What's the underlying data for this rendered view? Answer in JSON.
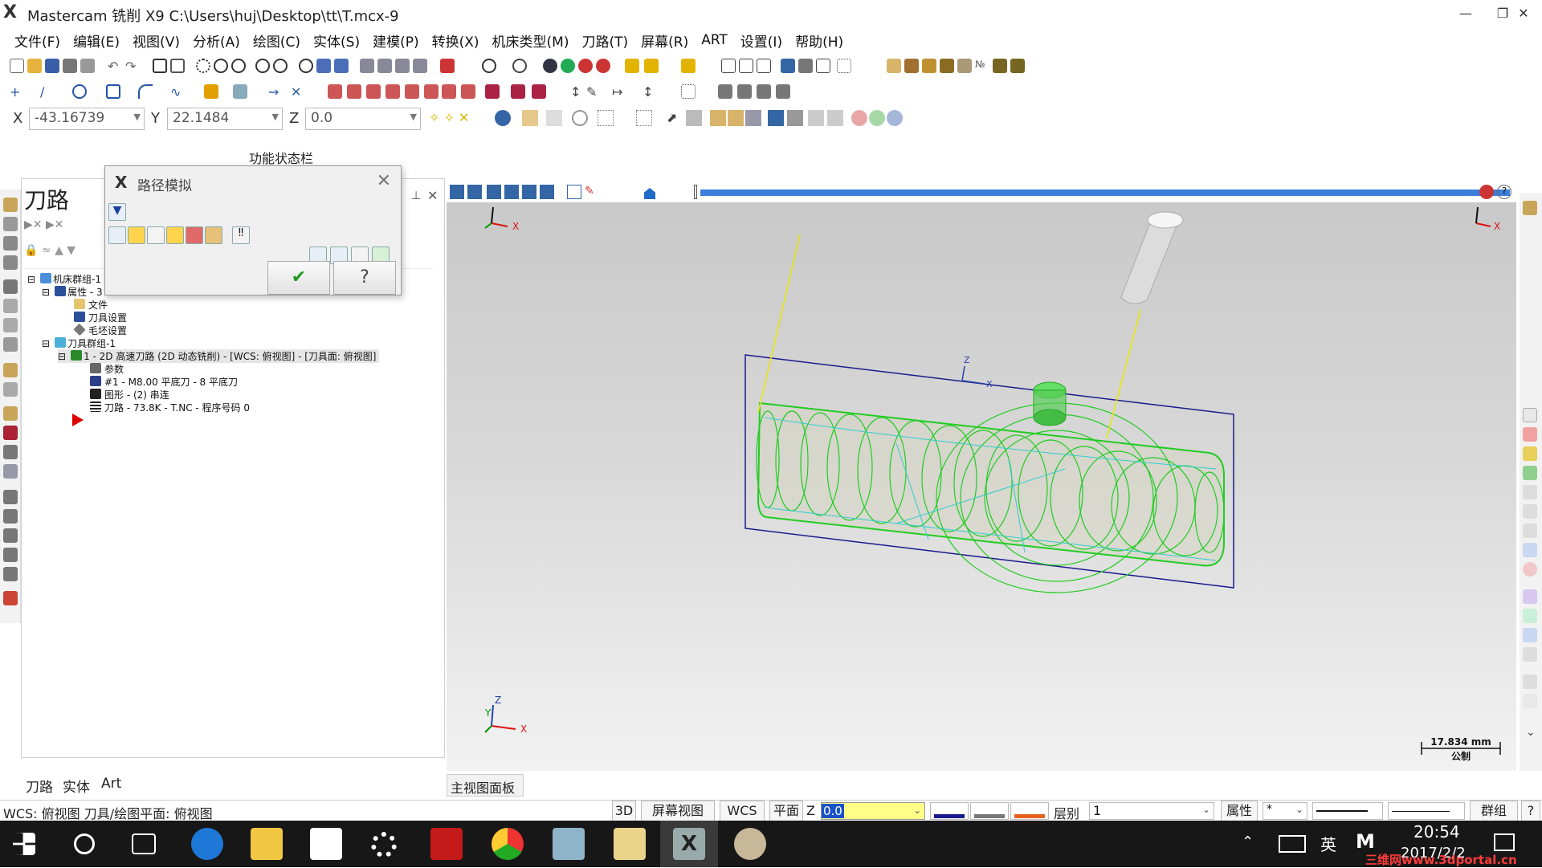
{
  "app": {
    "title": "Mastercam 铣削 X9  C:\\Users\\huj\\Desktop\\tt\\T.mcx-9"
  },
  "menu": [
    "文件(F)",
    "编辑(E)",
    "视图(V)",
    "分析(A)",
    "绘图(C)",
    "实体(S)",
    "建模(P)",
    "转换(X)",
    "机床类型(M)",
    "刀路(T)",
    "屏幕(R)",
    "ART",
    "设置(I)",
    "帮助(H)"
  ],
  "coords": {
    "x_label": "X",
    "x_value": "-43.16739",
    "y_label": "Y",
    "y_value": "22.1484",
    "z_label": "Z",
    "z_value": "0.0"
  },
  "function_status_label": "功能状态栏",
  "panel": {
    "title": "刀路",
    "tree": [
      "机床群组-1",
      "属性 - 3",
      "文件",
      "刀具设置",
      "毛坯设置",
      "刀具群组-1",
      "1 - 2D 高速刀路 (2D 动态铣削) - [WCS: 俯视图] - [刀具面: 俯视图]",
      "参数",
      "#1 - M8.00 平底刀 - 8 平底刀",
      "图形 - (2) 串连",
      "刀路 - 73.8K - T.NC - 程序号码 0"
    ],
    "tabs": [
      "刀路",
      "实体",
      "Art"
    ]
  },
  "dialog": {
    "title": "路径模拟"
  },
  "viewport": {
    "tab_label": "主视图面板",
    "axis_x": "X",
    "axis_y": "Y",
    "axis_z": "Z",
    "scale_value": "17.834 mm",
    "scale_unit": "公制"
  },
  "statusbar": {
    "wcs_text": "WCS: 俯视图  刀具/绘图平面: 俯视图",
    "btn_3d": "3D",
    "btn_screen_view": "屏幕视图",
    "btn_wcs": "WCS",
    "btn_plane": "平面",
    "z_label": "Z",
    "z_value": "0.0",
    "layer_label": "层别",
    "layer_value": "1",
    "attr_label": "属性",
    "group_label": "群组",
    "help": "?"
  },
  "taskbar": {
    "time": "20:54",
    "date": "2017/2/2",
    "ime": "英",
    "watermark": "三维网www.3dportal.cn"
  },
  "colors": {
    "toolpath_green": "#22cc22",
    "toolpath_cyan": "#33cccc",
    "stock_blue": "#1a1a8c",
    "simbar_blue": "#3d7fd9",
    "taskbar": "#171717"
  }
}
